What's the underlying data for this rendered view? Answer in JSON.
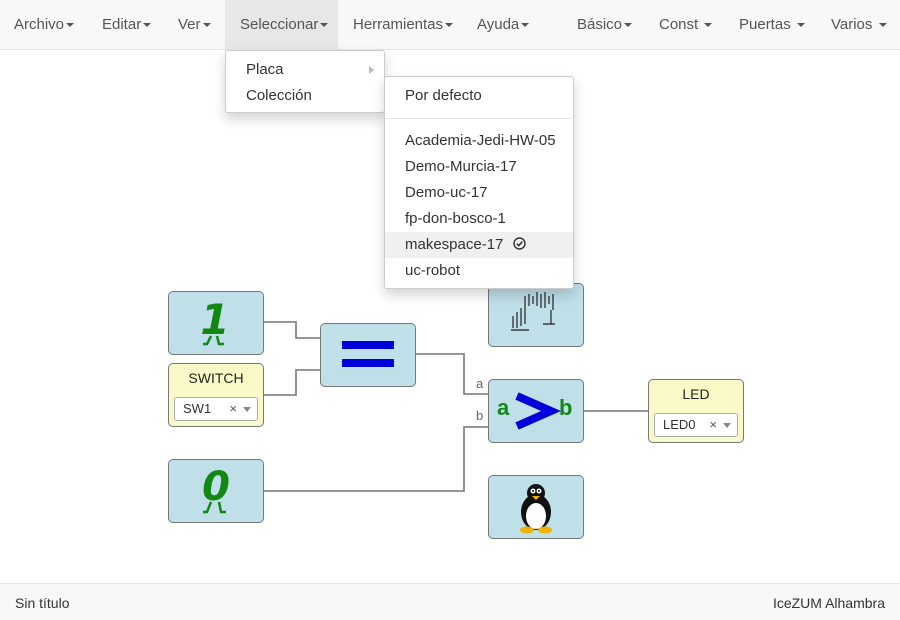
{
  "menubar": {
    "items": [
      {
        "label": "Archivo"
      },
      {
        "label": "Editar"
      },
      {
        "label": "Ver"
      },
      {
        "label": "Seleccionar"
      },
      {
        "label": "Herramientas"
      },
      {
        "label": "Ayuda"
      },
      {
        "label": "Básico"
      },
      {
        "label": "Const"
      },
      {
        "label": "Puertas"
      },
      {
        "label": "Varios"
      }
    ],
    "active_item": "Seleccionar"
  },
  "select_menu": {
    "items": [
      {
        "label": "Placa"
      },
      {
        "label": "Colección"
      }
    ]
  },
  "coleccion_submenu": {
    "default_item": "Por defecto",
    "items": [
      {
        "label": "Academia-Jedi-HW-05"
      },
      {
        "label": "Demo-Murcia-17"
      },
      {
        "label": "Demo-uc-17"
      },
      {
        "label": "fp-don-bosco-1"
      },
      {
        "label": "makespace-17",
        "checked": true
      },
      {
        "label": "uc-robot"
      }
    ]
  },
  "canvas": {
    "const_one": {
      "icon": "digit-one-icon"
    },
    "const_zero": {
      "icon": "digit-zero-icon"
    },
    "switch_block": {
      "title": "SWITCH",
      "value": "SW1",
      "clear": "×"
    },
    "equal_block": {
      "icon": "equal-icon"
    },
    "greater_block": {
      "left": "a",
      "right": "b"
    },
    "led_block": {
      "title": "LED",
      "value": "LED0",
      "clear": "×"
    },
    "port_a": "a",
    "port_b": "b",
    "signal_block": {
      "icon": "waveform-icon"
    },
    "linux_block": {
      "icon": "tux-penguin-icon"
    }
  },
  "colors": {
    "code_block": "#bfdfe9",
    "io_block": "#fafac8",
    "green": "#128712",
    "blue": "#0000dd"
  },
  "statusbar": {
    "left": "Sin título",
    "right": "IceZUM Alhambra"
  }
}
